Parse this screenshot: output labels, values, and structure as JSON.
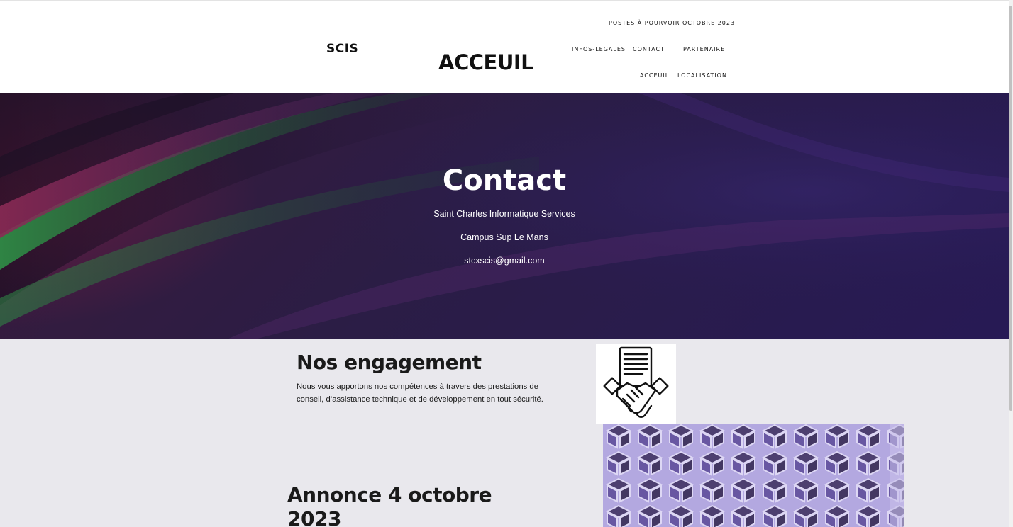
{
  "header": {
    "brand": "SCIS",
    "page_title": "ACCEUIL",
    "nav": {
      "postes": "POSTES À POURVOIR OCTOBRE 2023",
      "infos": "INFOS-LEGALES",
      "contact": "CONTACT",
      "partenaire": "PARTENAIRE",
      "acceuil": "ACCEUIL",
      "localisation": "LOCALISATION"
    }
  },
  "hero": {
    "title": "Contact",
    "company": "Saint Charles Informatique Services",
    "campus": "Campus Sup Le Mans",
    "email": "stcxscis@gmail.com"
  },
  "engagement": {
    "title": "Nos engagement",
    "text": "Nous vous apportons nos compétences à travers des prestations de conseil, d’assistance technique et de développement en tout sécurité."
  },
  "annonce": {
    "title_line1": "Annonce 4 octobre",
    "title_line2": "2023"
  },
  "icons": {
    "handshake": "handshake-contract-icon",
    "building": "building-facade-image"
  },
  "colors": {
    "hero_bg": "#2b1d45",
    "content_bg": "#e9e8ed",
    "text": "#111111"
  }
}
